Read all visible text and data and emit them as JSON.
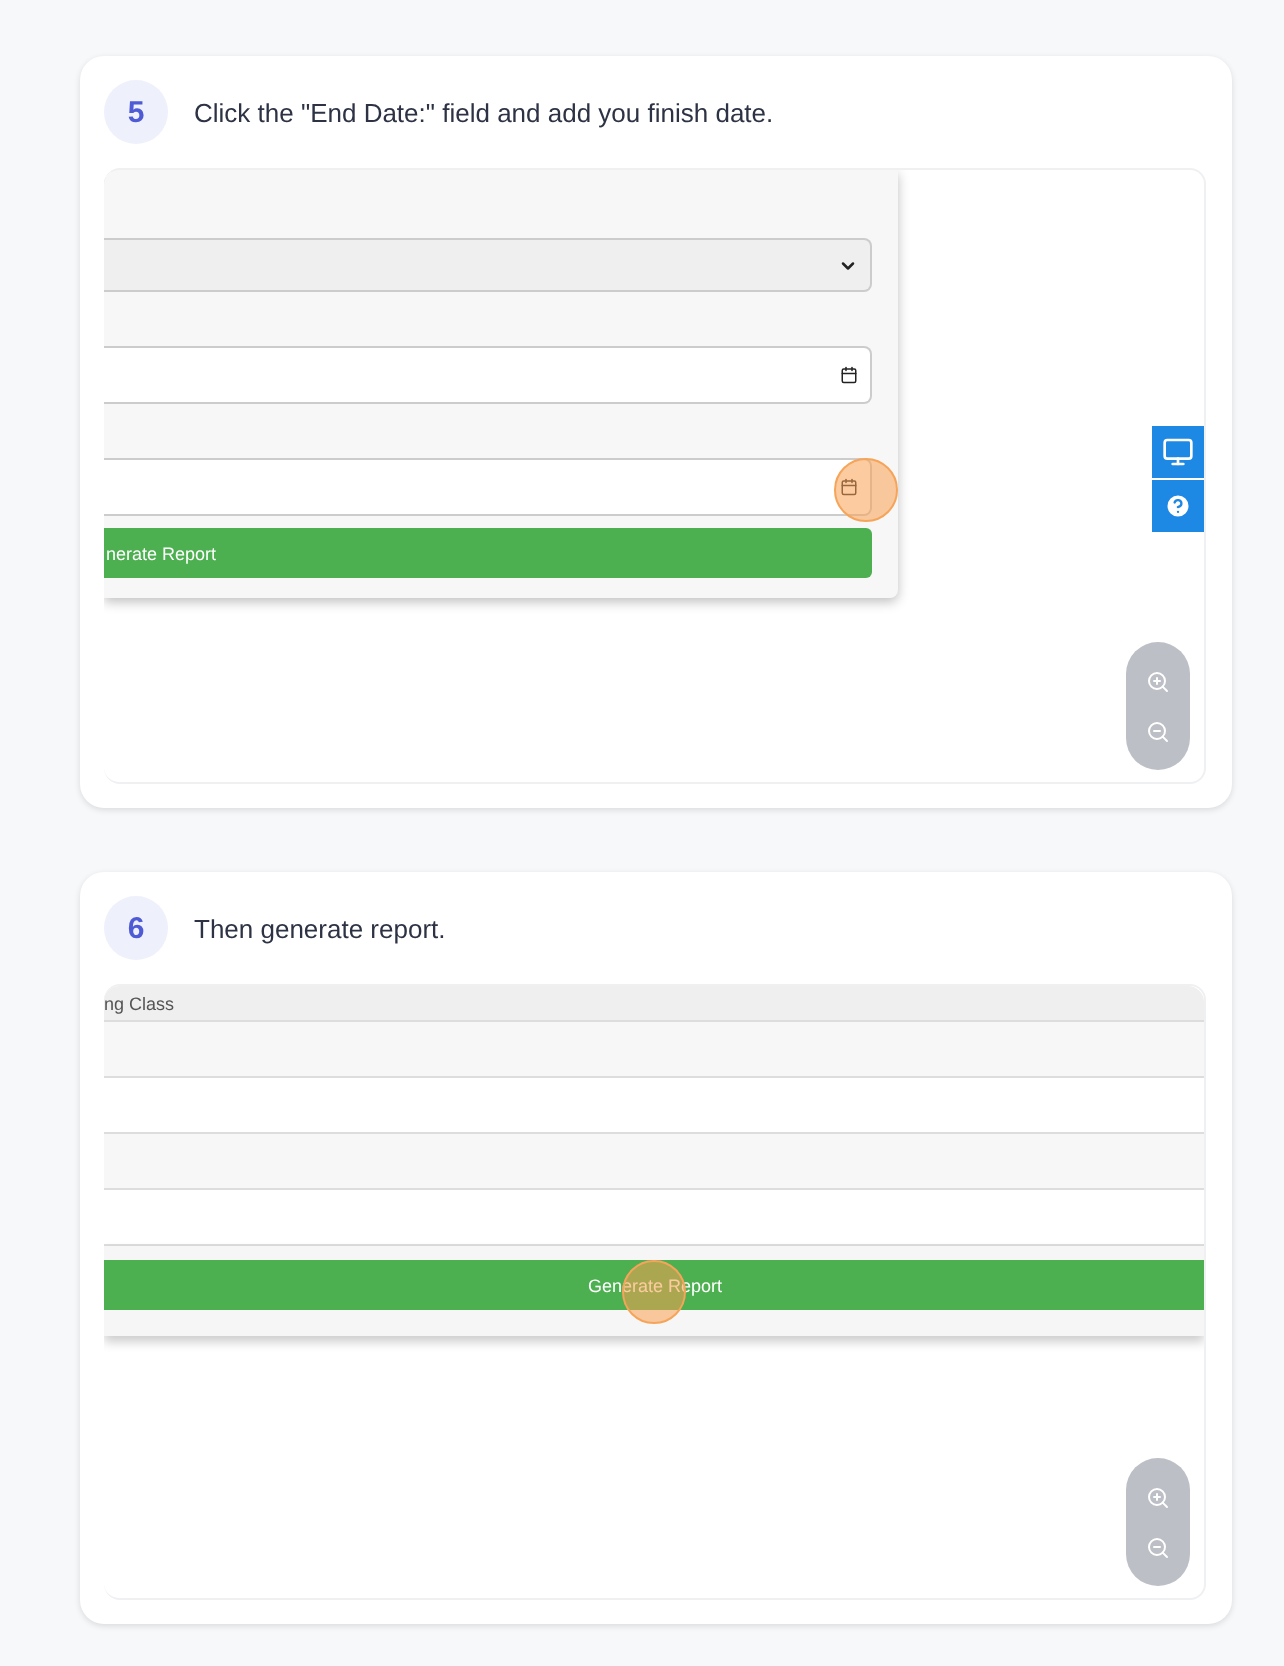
{
  "steps": [
    {
      "number": "5",
      "instruction": "Click the \"End Date:\" field and add you finish date.",
      "screenshot": {
        "kind": "form",
        "fields": [
          {
            "kind": "select"
          },
          {
            "kind": "date",
            "clicked": false
          },
          {
            "kind": "date",
            "clicked": true
          }
        ],
        "button": "nerate Report"
      }
    },
    {
      "number": "6",
      "instruction": "Then generate report.",
      "screenshot": {
        "kind": "table",
        "header": "ng Class",
        "button": "Generate Report",
        "clicked": true
      }
    }
  ]
}
